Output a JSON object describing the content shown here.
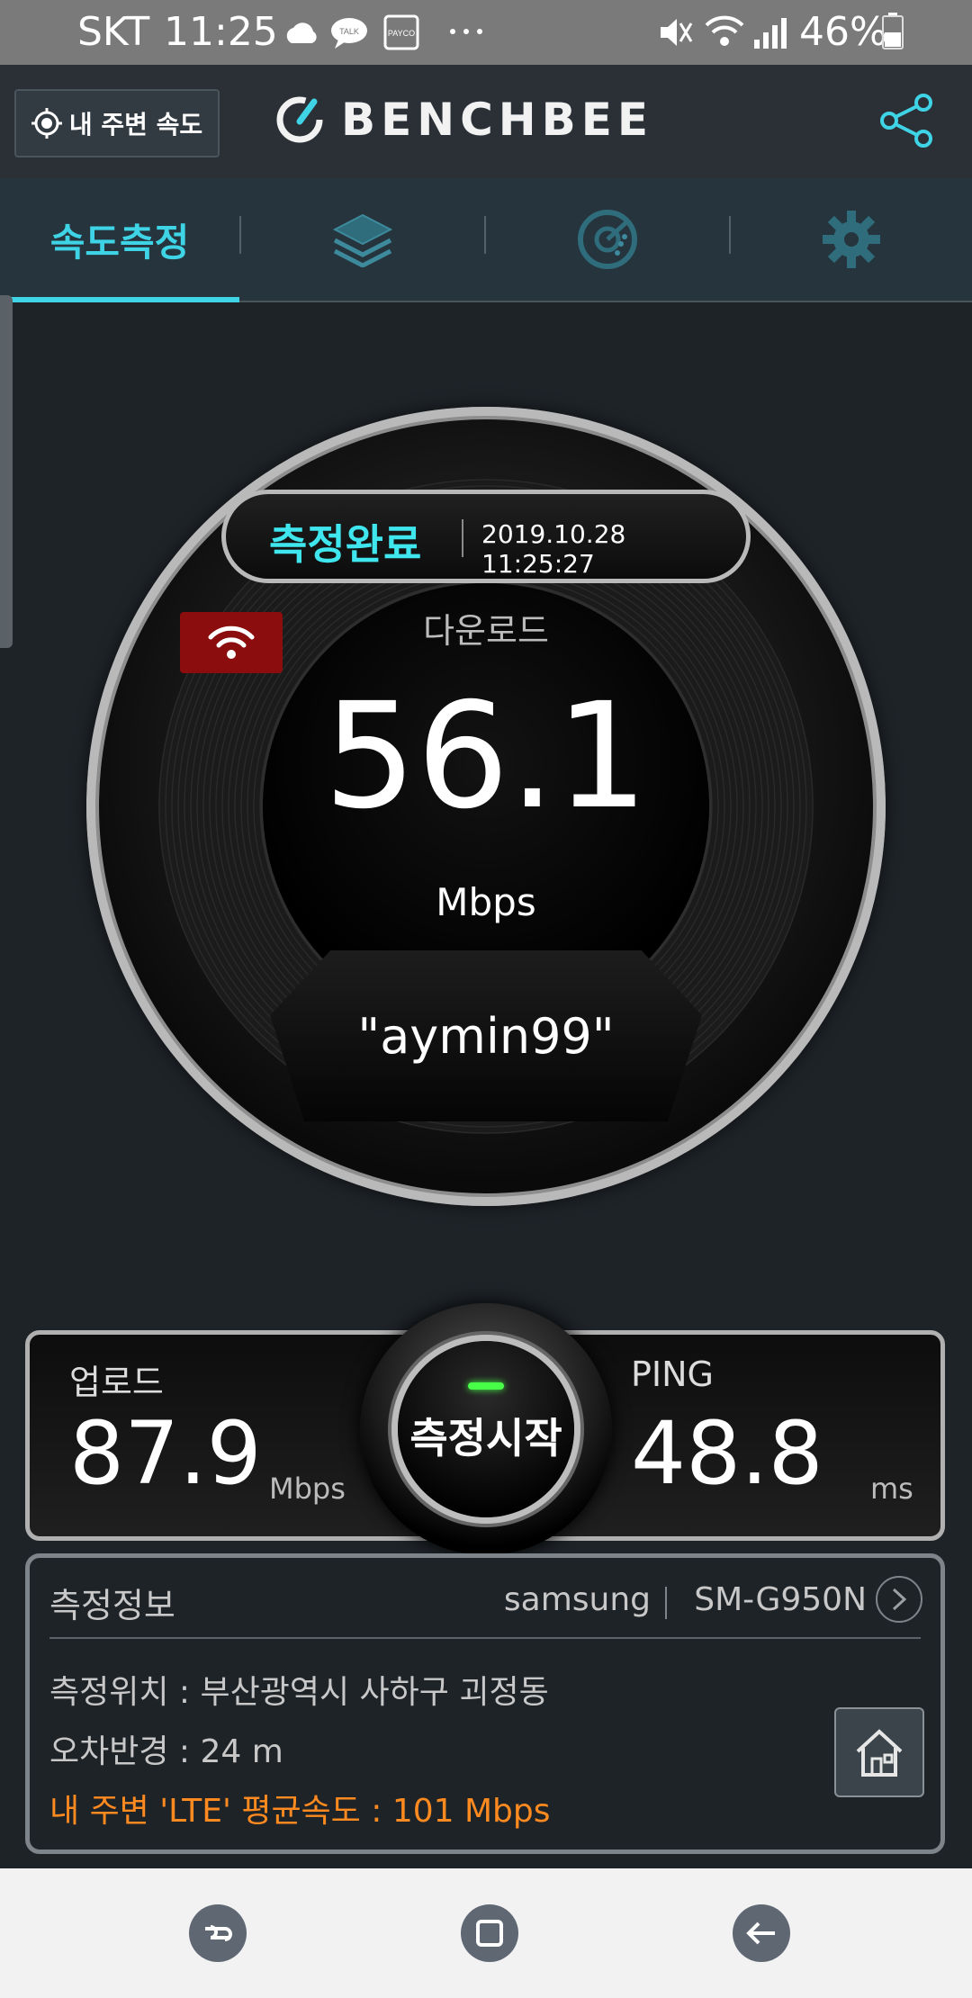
{
  "status_bar": {
    "carrier": "SKT",
    "time": "11:25",
    "battery": "46%"
  },
  "header": {
    "nearby_button_label": "내 주변 속도",
    "app_name": "BENCHBEE"
  },
  "tabs": [
    {
      "label": "속도측정",
      "icon": "speed-test",
      "active": true
    },
    {
      "label": "",
      "icon": "layers-icon",
      "active": false
    },
    {
      "label": "",
      "icon": "disc-chart-icon",
      "active": false
    },
    {
      "label": "",
      "icon": "gear-icon",
      "active": false
    }
  ],
  "gauge": {
    "status": "측정완료",
    "datetime": "2019.10.28 11:25:27",
    "download_label": "다운로드",
    "download_value": "56.1",
    "download_unit": "Mbps",
    "ssid": "\"aymin99\"",
    "connection_type": "wifi-icon"
  },
  "results": {
    "upload_label": "업로드",
    "upload_value": "87.9",
    "upload_unit": "Mbps",
    "ping_label": "PING",
    "ping_value": "48.8",
    "ping_unit": "ms",
    "start_button_label": "측정시작"
  },
  "info": {
    "title": "측정정보",
    "brand": "samsung",
    "model": "SM-G950N",
    "location": "측정위치 : 부산광역시  사하구 괴정동",
    "error_radius": "오차반경 : 24 m",
    "nearby_avg": "내 주변 'LTE' 평균속도 :  101 Mbps"
  },
  "colors": {
    "accent": "#3fd3e6",
    "status_done": "#3fe6ee",
    "wifi_badge": "#8b0d0d",
    "nearby_avg_text": "#ff8a1f",
    "background": "#1e2328"
  }
}
